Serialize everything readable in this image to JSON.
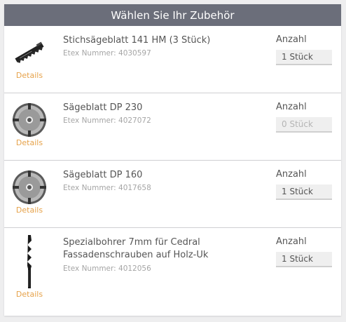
{
  "header": {
    "title": "Wählen Sie Ihr Zubehör"
  },
  "items": [
    {
      "title": "Stichsägeblatt 141 HM (3 Stück)",
      "sku": "Etex Nummer: 4030597",
      "details": "Details",
      "quantity_label": "Anzahl",
      "quantity": "1 Stück",
      "icon": "jigsaw-blade-icon"
    },
    {
      "title": "Sägeblatt DP 230",
      "sku": "Etex Nummer: 4027072",
      "details": "Details",
      "quantity_label": "Anzahl",
      "quantity": "0 Stück",
      "icon": "saw-blade-icon"
    },
    {
      "title": "Sägeblatt DP 160",
      "sku": "Etex Nummer: 4017658",
      "details": "Details",
      "quantity_label": "Anzahl",
      "quantity": "1 Stück",
      "icon": "saw-blade-icon"
    },
    {
      "title": "Spezialbohrer 7mm für Cedral Fassadenschrauben auf Holz-Uk",
      "sku": "Etex Nummer: 4012056",
      "details": "Details",
      "quantity_label": "Anzahl",
      "quantity": "1 Stück",
      "icon": "drill-bit-icon"
    }
  ],
  "colors": {
    "header_bg": "#6b6e7a",
    "link": "#e6a24a"
  }
}
